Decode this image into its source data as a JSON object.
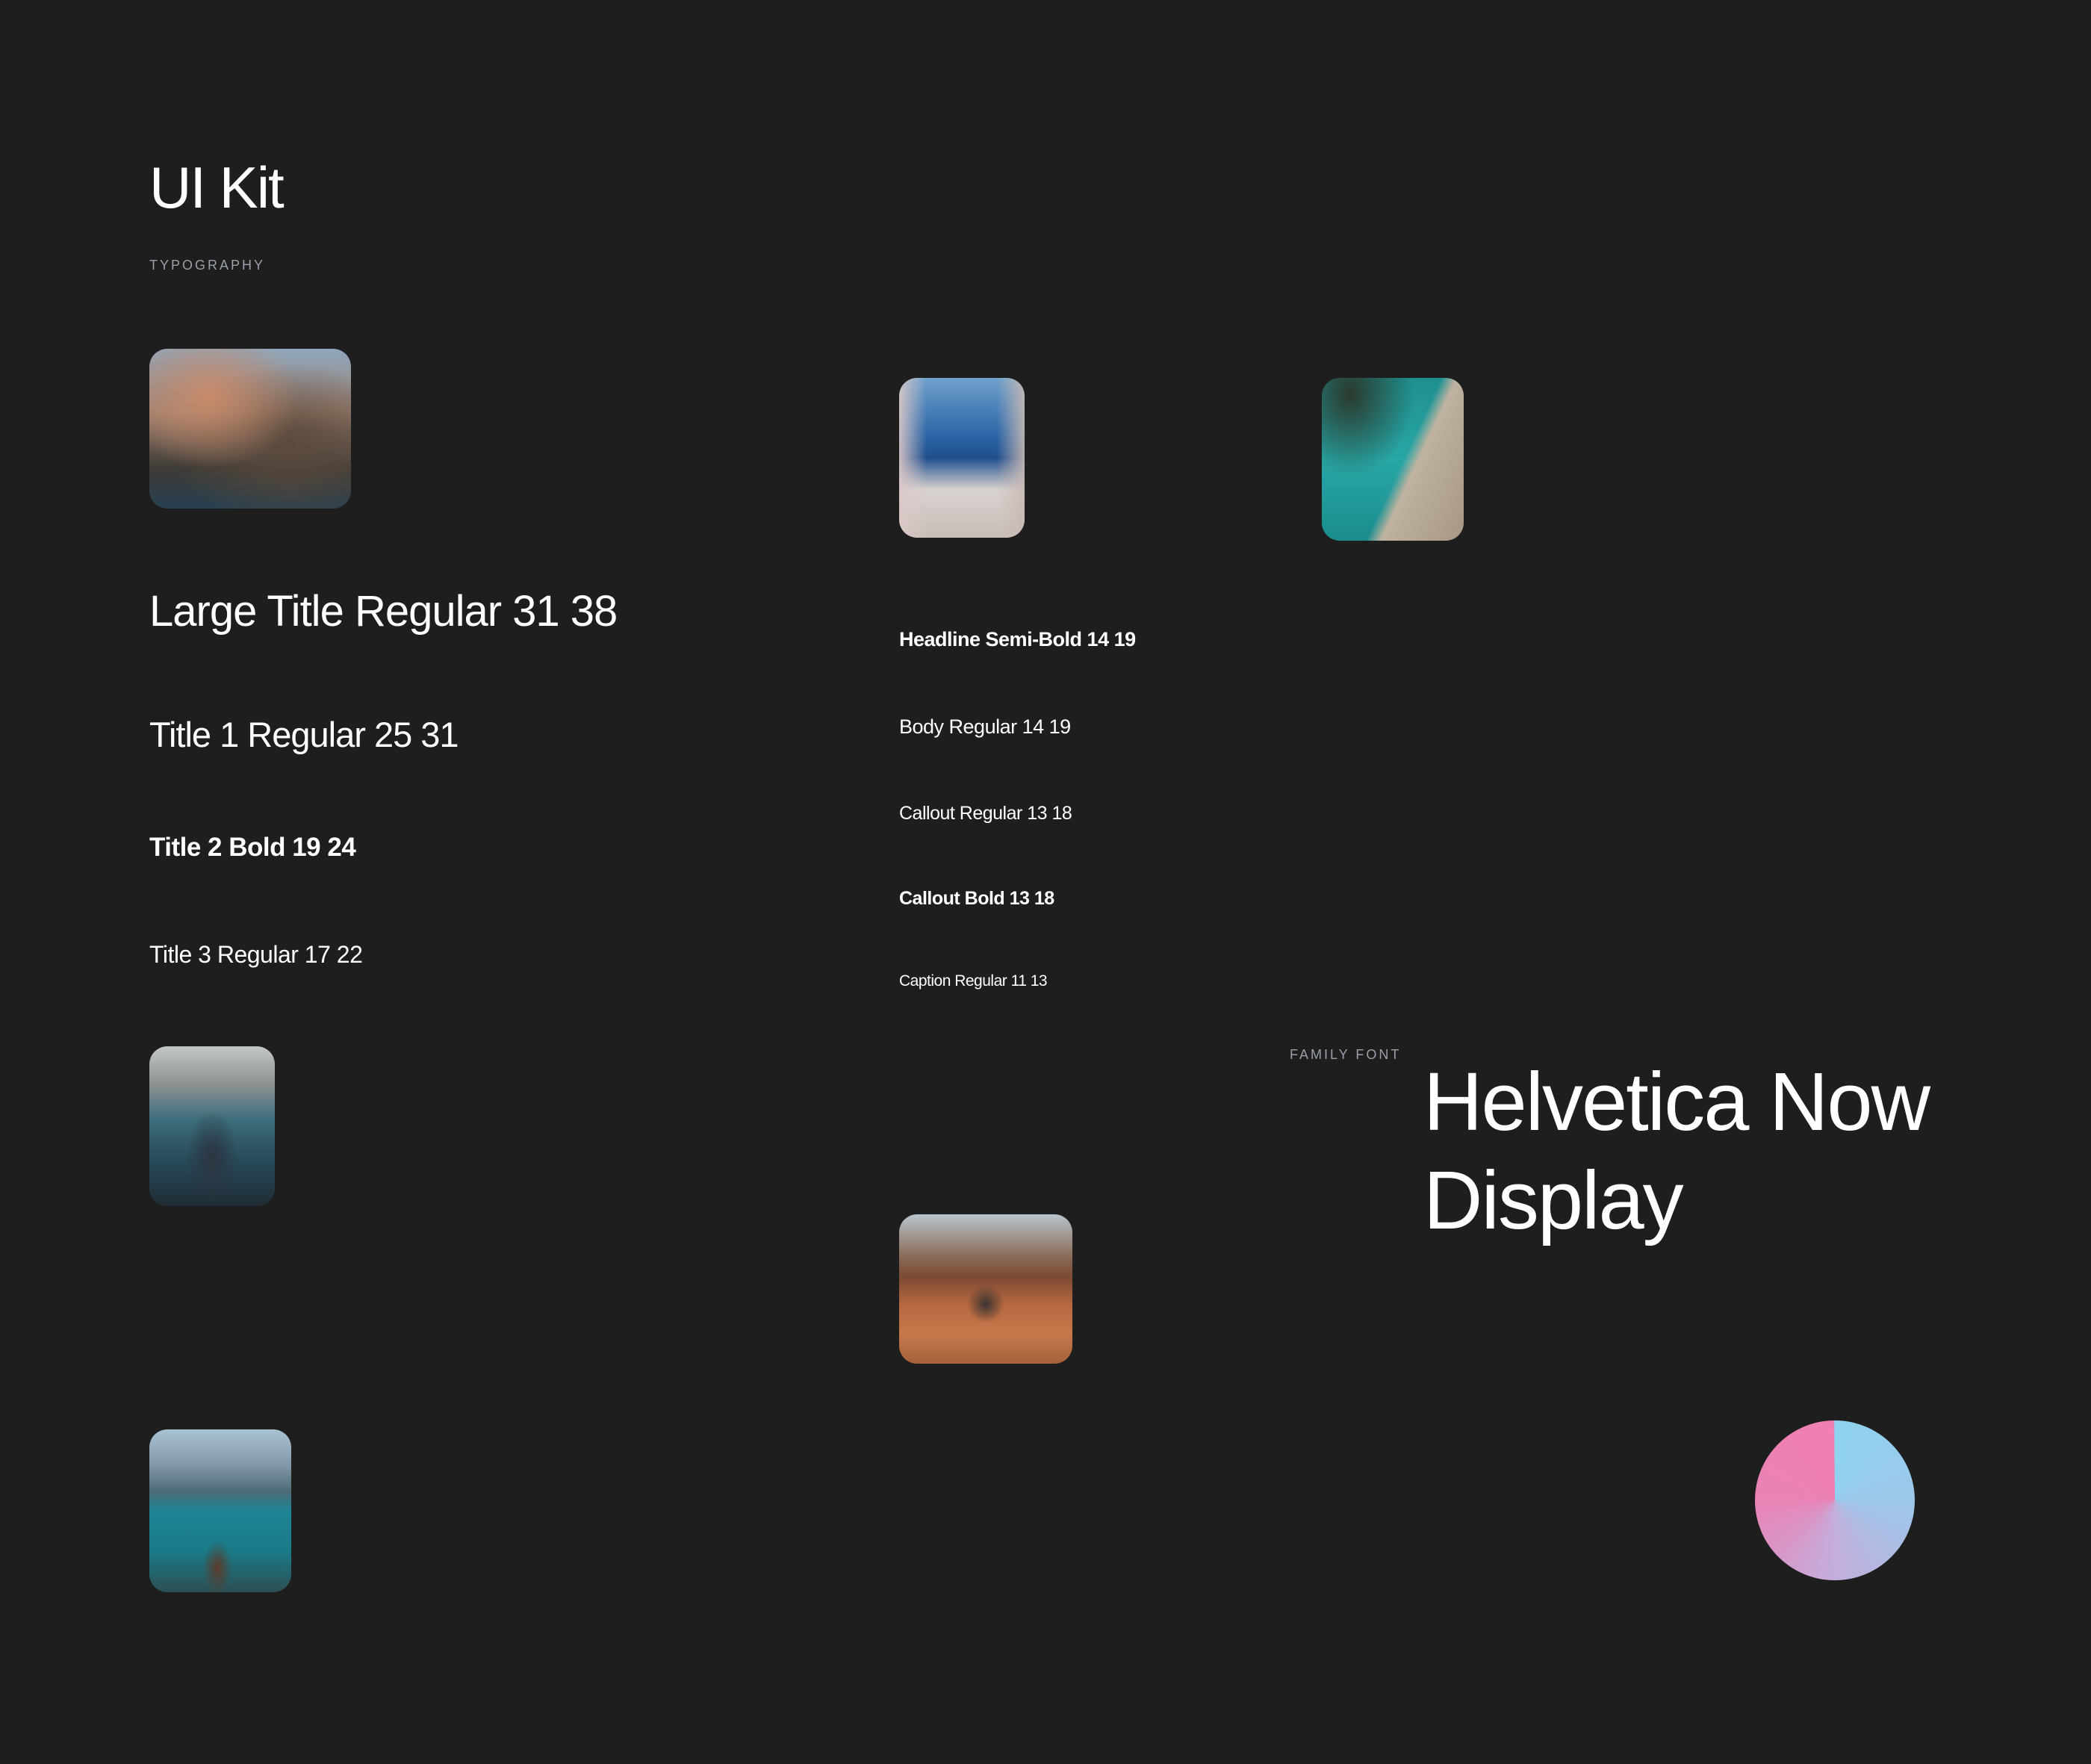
{
  "header": {
    "title": "UI Kit",
    "section_label": "TYPOGRAPHY"
  },
  "type_samples": {
    "large_title": "Large Title Regular 31 38",
    "title_1": "Title 1 Regular 25 31",
    "title_2": "Title 2 Bold 19 24",
    "title_3": "Title 3 Regular 17 22",
    "headline": "Headline Semi-Bold 14 19",
    "body": "Body Regular 14 19",
    "callout_regular": "Callout Regular 13 18",
    "callout_bold": "Callout Bold 13 18",
    "caption": "Caption Regular 11 13"
  },
  "family": {
    "label": "FAMILY FONT",
    "name_line_1": "Helvetica Now",
    "name_line_2": "Display"
  },
  "photos": [
    "coastal-cliff-village-photo",
    "santorini-sea-view-photo",
    "aerial-beach-boats-photo",
    "mountain-lake-boat-photo",
    "desert-hiker-photo",
    "moraine-lake-hiker-photo"
  ],
  "colors": {
    "background": "#1e1e1e",
    "text": "#ffffff",
    "muted_label": "#9aa0ab",
    "gradient_pink": "#f07fb2",
    "gradient_blue": "#8fd3ef"
  }
}
